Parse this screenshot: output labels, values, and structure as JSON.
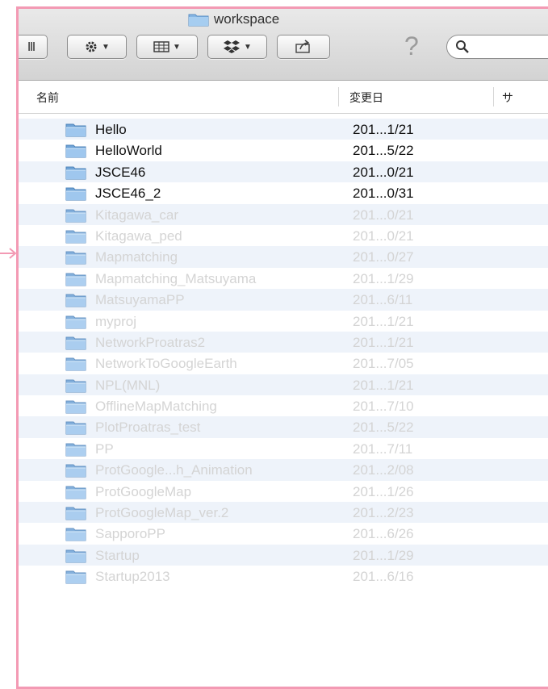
{
  "window": {
    "title": "workspace"
  },
  "toolbar": {
    "partial_button_label": "Ⅲ",
    "action_icon": "gear-icon",
    "arrange_icon": "grid-icon",
    "dropbox_icon": "dropbox-icon",
    "share_icon": "share-icon",
    "help_glyph": "?",
    "search_icon": "magnifier-icon",
    "search_value": ""
  },
  "columns": {
    "name": "名前",
    "date_modified": "変更日",
    "size_partial": "サ"
  },
  "files": [
    {
      "name": "Hello",
      "date": "201...1/21",
      "state": "active"
    },
    {
      "name": "HelloWorld",
      "date": "201...5/22",
      "state": "active"
    },
    {
      "name": "JSCE46",
      "date": "201...0/21",
      "state": "active"
    },
    {
      "name": "JSCE46_2",
      "date": "201...0/31",
      "state": "active"
    },
    {
      "name": "Kitagawa_car",
      "date": "201...0/21",
      "state": "dim"
    },
    {
      "name": "Kitagawa_ped",
      "date": "201...0/21",
      "state": "dim"
    },
    {
      "name": "Mapmatching",
      "date": "201...0/27",
      "state": "dim"
    },
    {
      "name": "Mapmatching_Matsuyama",
      "date": "201...1/29",
      "state": "dim"
    },
    {
      "name": "MatsuyamaPP",
      "date": "201...6/11",
      "state": "dim"
    },
    {
      "name": "myproj",
      "date": "201...1/21",
      "state": "dim"
    },
    {
      "name": "NetworkProatras2",
      "date": "201...1/21",
      "state": "dim"
    },
    {
      "name": "NetworkToGoogleEarth",
      "date": "201...7/05",
      "state": "dim"
    },
    {
      "name": "NPL(MNL)",
      "date": "201...1/21",
      "state": "dim"
    },
    {
      "name": "OfflineMapMatching",
      "date": "201...7/10",
      "state": "dim"
    },
    {
      "name": "PlotProatras_test",
      "date": "201...5/22",
      "state": "dim"
    },
    {
      "name": "PP",
      "date": "201...7/11",
      "state": "dim"
    },
    {
      "name": "ProtGoogle...h_Animation",
      "date": "201...2/08",
      "state": "dim"
    },
    {
      "name": "ProtGoogleMap",
      "date": "201...1/26",
      "state": "dim"
    },
    {
      "name": "ProtGoogleMap_ver.2",
      "date": "201...2/23",
      "state": "dim"
    },
    {
      "name": "SapporoPP",
      "date": "201...6/26",
      "state": "dim"
    },
    {
      "name": "Startup",
      "date": "201...1/29",
      "state": "dim"
    },
    {
      "name": "Startup2013",
      "date": "201...6/16",
      "state": "dim"
    }
  ],
  "colors": {
    "annotation_frame": "#f39ab4",
    "folder_blue": "#86b6e3",
    "row_alt": "#eef3fa",
    "dim_text": "#d4d4d4"
  }
}
